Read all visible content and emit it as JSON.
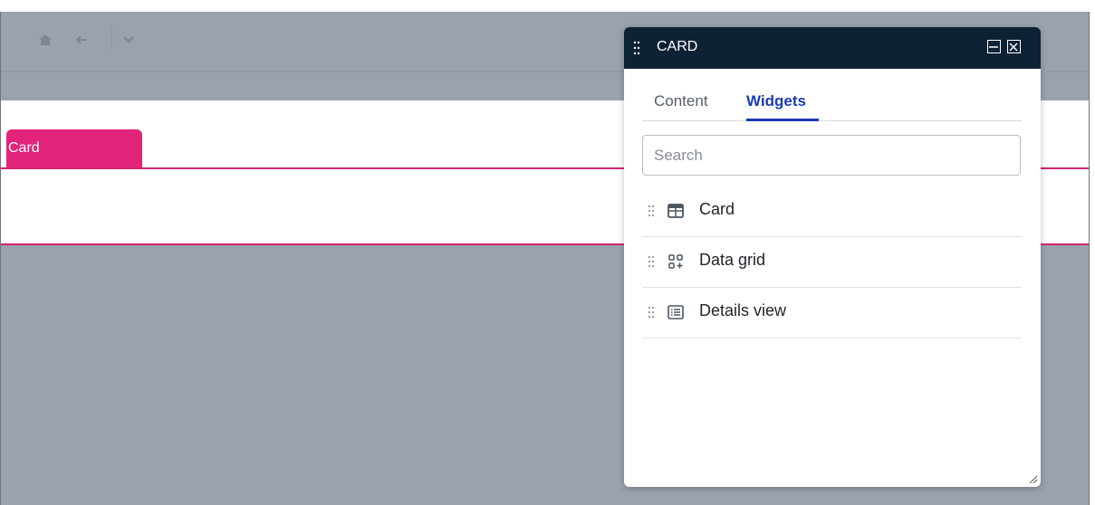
{
  "panel": {
    "title": "CARD",
    "tabs": [
      {
        "label": "Content"
      },
      {
        "label": "Widgets",
        "active": true
      }
    ],
    "search": {
      "placeholder": "Search",
      "value": ""
    },
    "widgets": [
      {
        "label": "Card",
        "icon": "table-layout-icon"
      },
      {
        "label": "Data grid",
        "icon": "grid-add-icon"
      },
      {
        "label": "Details view",
        "icon": "list-view-icon"
      }
    ]
  },
  "canvas": {
    "card_tab_label": "Card"
  },
  "colors": {
    "header_bg": "#0e2236",
    "accent_pink": "#e2247a",
    "active_tab": "#1b3bb3",
    "overlay": "#9aa3ad"
  }
}
